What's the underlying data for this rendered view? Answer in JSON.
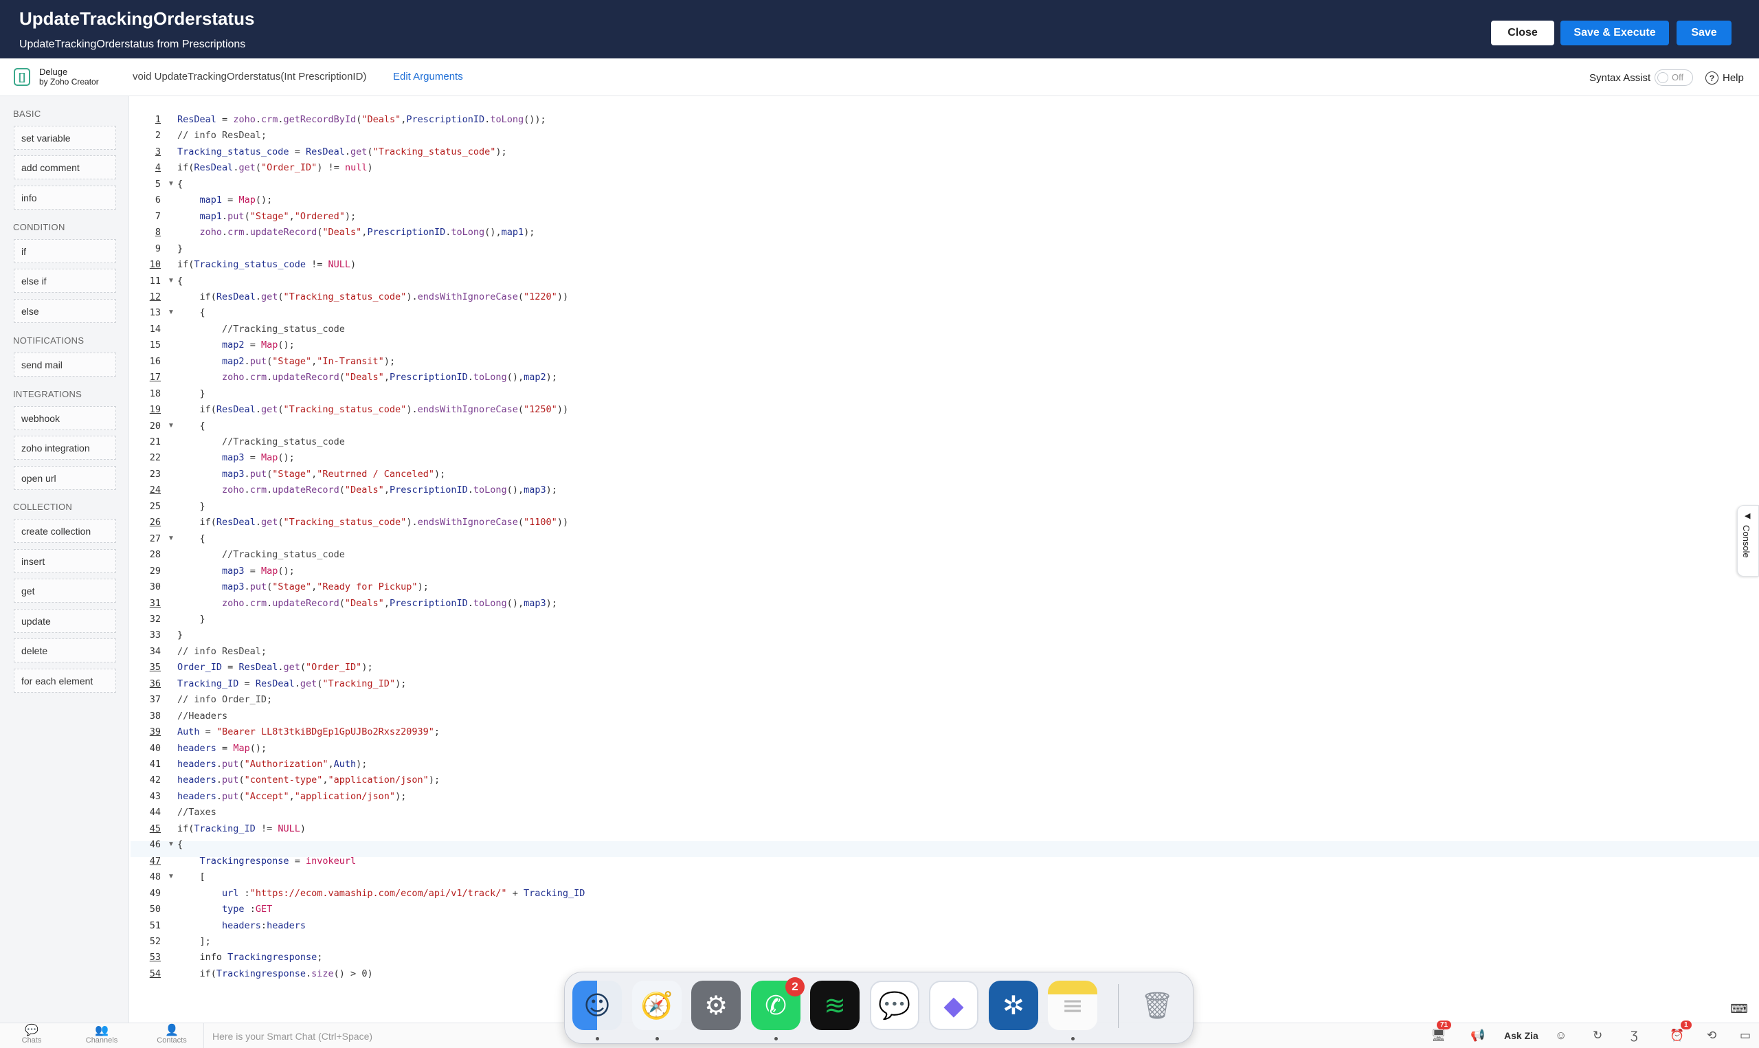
{
  "header": {
    "title": "UpdateTrackingOrderstatus",
    "subtitle": "UpdateTrackingOrderstatus from Prescriptions",
    "buttons": {
      "close": "Close",
      "save_execute": "Save & Execute",
      "save": "Save"
    }
  },
  "subheader": {
    "logo_symbol": "[]",
    "logo_line1": "Deluge",
    "logo_line2": "by Zoho Creator",
    "function_signature": "void  UpdateTrackingOrderstatus(Int PrescriptionID)",
    "edit_arguments": "Edit Arguments",
    "syntax_assist_label": "Syntax Assist",
    "syntax_assist_state": "Off",
    "help_symbol": "?",
    "help_label": "Help"
  },
  "sidebar": {
    "groups": [
      {
        "title": "BASIC",
        "items": [
          "set variable",
          "add comment",
          "info"
        ]
      },
      {
        "title": "CONDITION",
        "items": [
          "if",
          "else if",
          "else"
        ]
      },
      {
        "title": "NOTIFICATIONS",
        "items": [
          "send mail"
        ]
      },
      {
        "title": "INTEGRATIONS",
        "items": [
          "webhook",
          "zoho integration",
          "open url"
        ]
      },
      {
        "title": "COLLECTION",
        "items": [
          "create collection",
          "insert",
          "get",
          "update",
          "delete",
          "for each element"
        ]
      }
    ]
  },
  "editor": {
    "underlined_line_numbers": [
      1,
      3,
      4,
      8,
      10,
      12,
      17,
      19,
      24,
      26,
      31,
      35,
      36,
      39,
      45,
      47,
      53,
      54
    ],
    "folded_lines": [
      5,
      11,
      13,
      20,
      27,
      46,
      48
    ],
    "lines": [
      "ResDeal = zoho.crm.getRecordById(\"Deals\",PrescriptionID.toLong());",
      "// info ResDeal;",
      "Tracking_status_code = ResDeal.get(\"Tracking_status_code\");",
      "if(ResDeal.get(\"Order_ID\") != null)",
      "{",
      "    map1 = Map();",
      "    map1.put(\"Stage\",\"Ordered\");",
      "    zoho.crm.updateRecord(\"Deals\",PrescriptionID.toLong(),map1);",
      "}",
      "if(Tracking_status_code != NULL)",
      "{",
      "    if(ResDeal.get(\"Tracking_status_code\").endsWithIgnoreCase(\"1220\"))",
      "    {",
      "        //Tracking_status_code",
      "        map2 = Map();",
      "        map2.put(\"Stage\",\"In-Transit\");",
      "        zoho.crm.updateRecord(\"Deals\",PrescriptionID.toLong(),map2);",
      "    }",
      "    if(ResDeal.get(\"Tracking_status_code\").endsWithIgnoreCase(\"1250\"))",
      "    {",
      "        //Tracking_status_code",
      "        map3 = Map();",
      "        map3.put(\"Stage\",\"Reutrned / Canceled\");",
      "        zoho.crm.updateRecord(\"Deals\",PrescriptionID.toLong(),map3);",
      "    }",
      "    if(ResDeal.get(\"Tracking_status_code\").endsWithIgnoreCase(\"1100\"))",
      "    {",
      "        //Tracking_status_code",
      "        map3 = Map();",
      "        map3.put(\"Stage\",\"Ready for Pickup\");",
      "        zoho.crm.updateRecord(\"Deals\",PrescriptionID.toLong(),map3);",
      "    }",
      "}",
      "// info ResDeal;",
      "Order_ID = ResDeal.get(\"Order_ID\");",
      "Tracking_ID = ResDeal.get(\"Tracking_ID\");",
      "// info Order_ID;",
      "//Headers",
      "Auth = \"Bearer LL8t3tkiBDgEp1GpUJBo2Rxsz20939\";",
      "headers = Map();",
      "headers.put(\"Authorization\",Auth);",
      "headers.put(\"content-type\",\"application/json\");",
      "headers.put(\"Accept\",\"application/json\");",
      "//Taxes",
      "if(Tracking_ID != NULL)",
      "{",
      "    Trackingresponse = invokeurl",
      "    [",
      "        url :\"https://ecom.vamaship.com/ecom/api/v1/track/\" + Tracking_ID",
      "        type :GET",
      "        headers:headers",
      "    ];",
      "    info Trackingresponse;",
      "    if(Trackingresponse.size() > 0)"
    ]
  },
  "console_tab": {
    "label": "Console",
    "arrow": "◀"
  },
  "keyboard_icon": "⌨",
  "bottom_bar": {
    "left_items": [
      {
        "label": "Chats",
        "icon": "chat-bubble-icon"
      },
      {
        "label": "Channels",
        "icon": "people-icon"
      },
      {
        "label": "Contacts",
        "icon": "person-icon"
      }
    ],
    "chat_placeholder": "Here is your Smart Chat (Ctrl+Space)",
    "ask_zia": "Ask Zia",
    "notification_count": "71",
    "alarm_count": "1"
  },
  "dock": {
    "apps": [
      "Finder",
      "Safari",
      "System Settings",
      "WhatsApp",
      "Spotify",
      "Speeko",
      "ClickUp",
      "Perplexity",
      "Notes",
      "Trash"
    ],
    "whatsapp_badge": "2",
    "colors": {
      "finder": "#3a8cf0",
      "safari": "#1f8ef1",
      "settings": "#6b6f76",
      "whatsapp": "#25d366",
      "spotify": "#1db954",
      "clickup": "#7b68ee",
      "perplexity": "#1b5fa8",
      "notes": "#f6d548"
    }
  },
  "colors": {
    "header_bg": "#1e2a47",
    "primary_button": "#1379e6",
    "string": "#b51e1e",
    "identifier": "#1f2f8f"
  }
}
